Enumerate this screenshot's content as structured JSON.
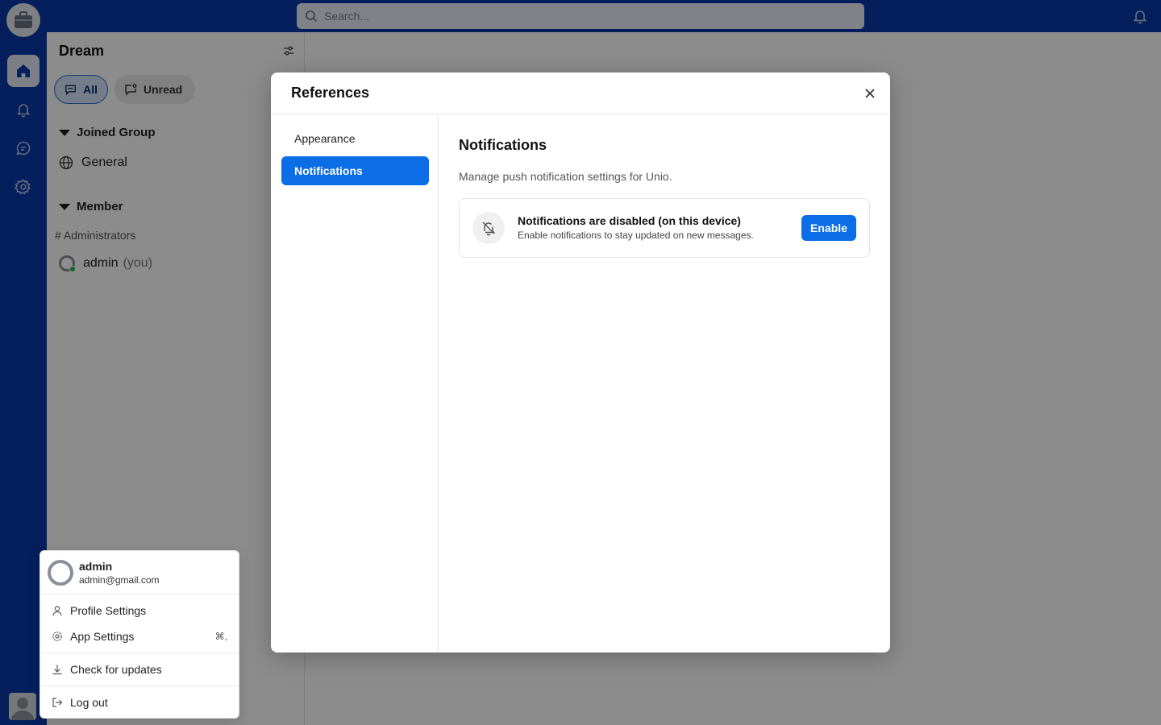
{
  "search": {
    "placeholder": "Search..."
  },
  "sidebar": {
    "workspace_title": "Dream",
    "filters": [
      {
        "label": "All",
        "selected": true
      },
      {
        "label": "Unread",
        "selected": false
      }
    ],
    "sections": {
      "joined_group": {
        "label": "Joined Group",
        "items": [
          {
            "label": "General",
            "icon": "globe-icon"
          }
        ]
      },
      "member": {
        "label": "Member",
        "subheading": "# Administrators",
        "me": {
          "name": "admin",
          "suffix": "(you)",
          "status": "online"
        }
      }
    }
  },
  "account_menu": {
    "name": "admin",
    "email": "admin@gmail.com",
    "items": [
      {
        "label": "Profile Settings",
        "icon": "user-icon"
      },
      {
        "label": "App Settings",
        "icon": "gear-icon",
        "shortcut": "⌘,"
      },
      {
        "label": "Check for updates",
        "icon": "download-icon"
      },
      {
        "label": "Log out",
        "icon": "logout-icon"
      }
    ]
  },
  "modal": {
    "title": "References",
    "nav": [
      {
        "label": "Appearance",
        "active": false
      },
      {
        "label": "Notifications",
        "active": true
      }
    ],
    "body": {
      "title": "Notifications",
      "description": "Manage push notification settings for Unio.",
      "card": {
        "title": "Notifications are disabled (on this device)",
        "subtitle": "Enable notifications to stay updated on new messages.",
        "button": "Enable"
      }
    }
  },
  "colors": {
    "rail": "#0a3aa8",
    "accent": "#0b6ee6",
    "online": "#2bb24c"
  }
}
